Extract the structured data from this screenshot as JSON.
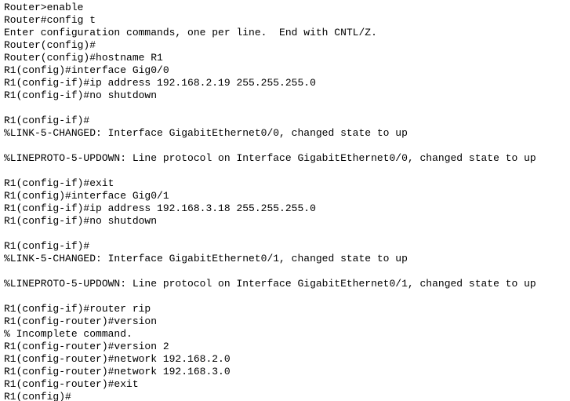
{
  "terminal": {
    "device_prompt_initial": "Router",
    "device_prompt_renamed": "R1",
    "background_color": "#ffffff",
    "text_color": "#000000",
    "lines": [
      "Router>enable",
      "Router#config t",
      "Enter configuration commands, one per line.  End with CNTL/Z.",
      "Router(config)#",
      "Router(config)#hostname R1",
      "R1(config)#interface Gig0/0",
      "R1(config-if)#ip address 192.168.2.19 255.255.255.0",
      "R1(config-if)#no shutdown",
      "",
      "R1(config-if)#",
      "%LINK-5-CHANGED: Interface GigabitEthernet0/0, changed state to up",
      "",
      "%LINEPROTO-5-UPDOWN: Line protocol on Interface GigabitEthernet0/0, changed state to up",
      "",
      "R1(config-if)#exit",
      "R1(config)#interface Gig0/1",
      "R1(config-if)#ip address 192.168.3.18 255.255.255.0",
      "R1(config-if)#no shutdown",
      "",
      "R1(config-if)#",
      "%LINK-5-CHANGED: Interface GigabitEthernet0/1, changed state to up",
      "",
      "%LINEPROTO-5-UPDOWN: Line protocol on Interface GigabitEthernet0/1, changed state to up",
      "",
      "R1(config-if)#router rip",
      "R1(config-router)#version",
      "% Incomplete command.",
      "R1(config-router)#version 2",
      "R1(config-router)#network 192.168.2.0",
      "R1(config-router)#network 192.168.3.0",
      "R1(config-router)#exit",
      "R1(config)#"
    ]
  }
}
